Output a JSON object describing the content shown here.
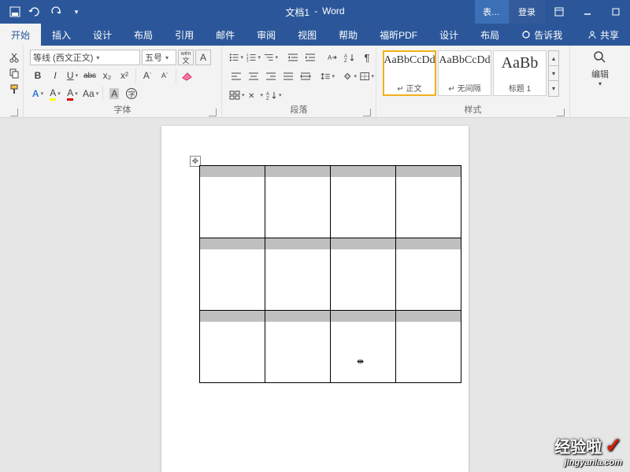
{
  "title": {
    "doc": "文档1",
    "app": "Word"
  },
  "titlebar": {
    "context_tab": "表…",
    "login": "登录"
  },
  "tabs": {
    "home": "开始",
    "insert": "插入",
    "design": "设计",
    "layout": "布局",
    "references": "引用",
    "mailings": "邮件",
    "review": "审阅",
    "view": "视图",
    "help": "帮助",
    "foxit": "福昕PDF",
    "tdesign": "设计",
    "tlayout": "布局",
    "tell": "告诉我",
    "share": "共享"
  },
  "font": {
    "name": "等线 (西文正文)",
    "size": "五号",
    "bold": "B",
    "italic": "I",
    "underline": "U",
    "strike": "abc",
    "sub": "x₂",
    "sup": "x²",
    "pinyin": "wén",
    "charborder": "A",
    "effects": "A",
    "highlight": "A",
    "fontcolor": "A",
    "case": "Aa",
    "grow": "A",
    "shrink": "A",
    "charshade": "A",
    "clear": "A",
    "group": "字体"
  },
  "para": {
    "bullets": "≡",
    "numbering": "≡",
    "multilevel": "≡",
    "dec_indent": "≤",
    "inc_indent": "≥",
    "sort": "A↓",
    "marks": "¶",
    "align_l": "≡",
    "align_c": "≡",
    "align_r": "≡",
    "align_j": "≡",
    "linespace": "↕",
    "shading": "▦",
    "borders": "▦",
    "group": "段落"
  },
  "styles": {
    "preview": "AaBbCcDd",
    "s1": "↵ 正文",
    "s2": "↵ 无间隔",
    "preview3": "AaBb",
    "s3": "标题 1",
    "group": "样式"
  },
  "editing": {
    "label": "编辑"
  },
  "watermark": {
    "main": "经验啦",
    "check": "✓",
    "sub": "jingyanla.com"
  }
}
